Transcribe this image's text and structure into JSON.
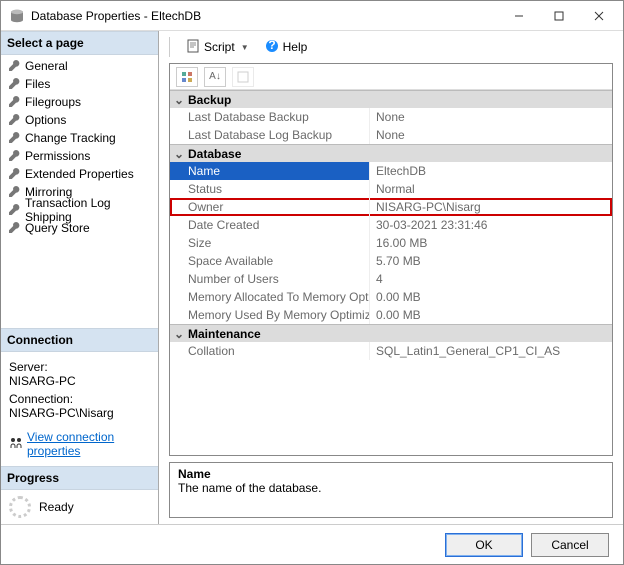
{
  "window": {
    "title": "Database Properties - EltechDB"
  },
  "left": {
    "select_page": "Select a page",
    "pages": [
      "General",
      "Files",
      "Filegroups",
      "Options",
      "Change Tracking",
      "Permissions",
      "Extended Properties",
      "Mirroring",
      "Transaction Log Shipping",
      "Query Store"
    ],
    "connection_header": "Connection",
    "server_label": "Server:",
    "server_value": "NISARG-PC",
    "connection_label": "Connection:",
    "connection_value": "NISARG-PC\\Nisarg",
    "view_conn_link": "View connection properties",
    "progress_header": "Progress",
    "progress_status": "Ready"
  },
  "toolbar": {
    "script": "Script",
    "help": "Help"
  },
  "grid": {
    "categories": [
      {
        "name": "Backup",
        "rows": [
          {
            "k": "Last Database Backup",
            "v": "None"
          },
          {
            "k": "Last Database Log Backup",
            "v": "None"
          }
        ]
      },
      {
        "name": "Database",
        "rows": [
          {
            "k": "Name",
            "v": "EltechDB",
            "selected": true
          },
          {
            "k": "Status",
            "v": "Normal"
          },
          {
            "k": "Owner",
            "v": "NISARG-PC\\Nisarg",
            "highlight": true
          },
          {
            "k": "Date Created",
            "v": "30-03-2021 23:31:46"
          },
          {
            "k": "Size",
            "v": "16.00 MB"
          },
          {
            "k": "Space Available",
            "v": "5.70 MB"
          },
          {
            "k": "Number of Users",
            "v": "4"
          },
          {
            "k": "Memory Allocated To Memory Optimized Objects",
            "v": "0.00 MB"
          },
          {
            "k": "Memory Used By Memory Optimized Objects",
            "v": "0.00 MB"
          }
        ]
      },
      {
        "name": "Maintenance",
        "rows": [
          {
            "k": "Collation",
            "v": "SQL_Latin1_General_CP1_CI_AS"
          }
        ]
      }
    ]
  },
  "description": {
    "title": "Name",
    "text": "The name of the database."
  },
  "buttons": {
    "ok": "OK",
    "cancel": "Cancel"
  }
}
